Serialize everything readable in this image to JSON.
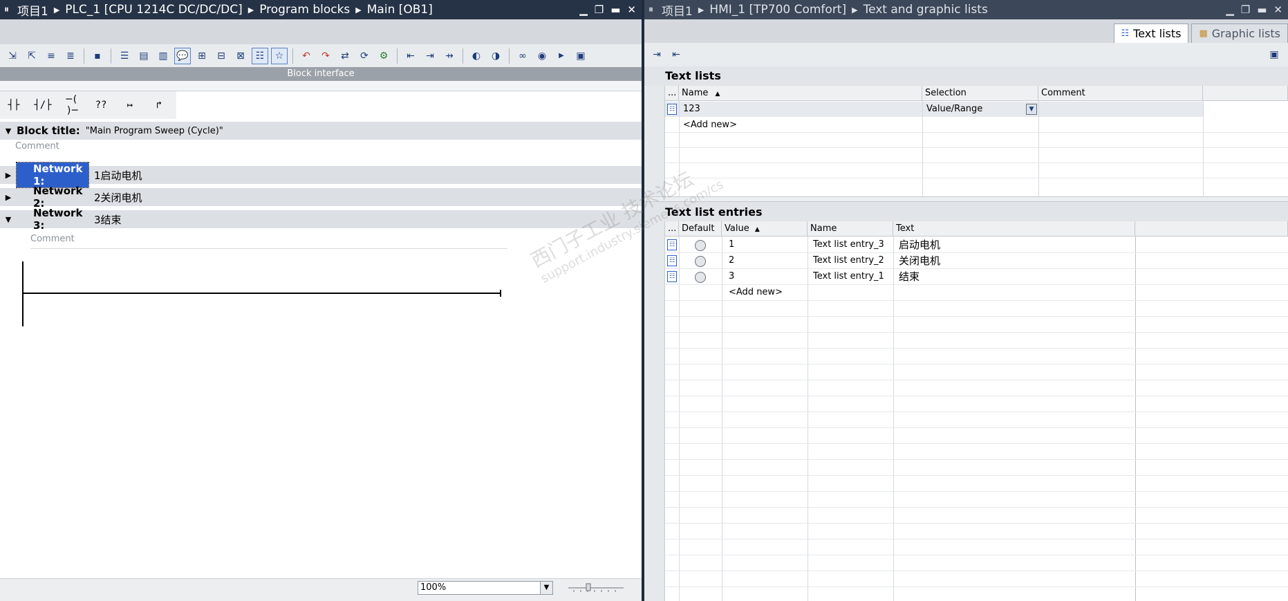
{
  "left": {
    "breadcrumb": [
      "项目1",
      "PLC_1 [CPU 1214C DC/DC/DC]",
      "Program blocks",
      "Main [OB1]"
    ],
    "block_interface_label": "Block interface",
    "ladder_tools": [
      "┤├",
      "┤/├",
      "─( )─",
      "??",
      "↦",
      "↱"
    ],
    "block_title_label": "Block title:",
    "block_title_value": "\"Main Program Sweep (Cycle)\"",
    "comment_placeholder": "Comment",
    "networks": [
      {
        "label": "Network 1:",
        "title": "1启动电机",
        "expanded": false,
        "selected": true
      },
      {
        "label": "Network 2:",
        "title": "2关闭电机",
        "expanded": false,
        "selected": false
      },
      {
        "label": "Network 3:",
        "title": "3结束",
        "expanded": true,
        "selected": false
      }
    ],
    "network_comment_placeholder": "Comment",
    "zoom": "100%"
  },
  "right": {
    "breadcrumb": [
      "项目1",
      "HMI_1 [TP700 Comfort]",
      "Text and graphic lists"
    ],
    "tabs": [
      {
        "label": "Text lists",
        "active": true
      },
      {
        "label": "Graphic lists",
        "active": false
      }
    ],
    "text_lists": {
      "title": "Text lists",
      "columns": [
        "...",
        "Name",
        "Selection",
        "Comment"
      ],
      "rows": [
        {
          "name": "123",
          "selection": "Value/Range",
          "comment": ""
        }
      ],
      "add_new": "<Add new>"
    },
    "entries": {
      "title": "Text list entries",
      "columns": [
        "...",
        "Default",
        "Value",
        "Name",
        "Text"
      ],
      "rows": [
        {
          "value": "1",
          "name": "Text list entry_3",
          "text": "启动电机"
        },
        {
          "value": "2",
          "name": "Text list entry_2",
          "text": "关闭电机"
        },
        {
          "value": "3",
          "name": "Text list entry_1",
          "text": "结束"
        }
      ],
      "add_new": "<Add new>"
    }
  },
  "watermark": {
    "line1": "西门子工业 技术论坛",
    "line2": "support.industry.siemens.com/cs"
  }
}
